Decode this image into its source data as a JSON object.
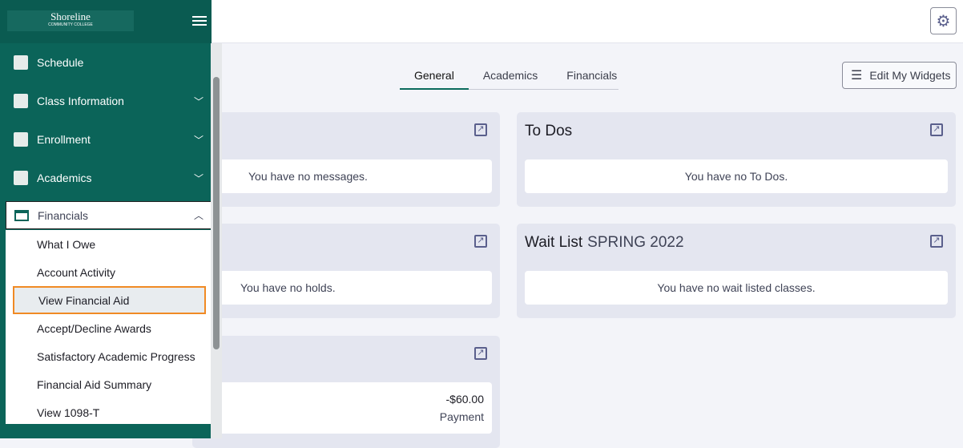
{
  "header": {
    "settings_icon": "gear-icon"
  },
  "tabs": [
    {
      "label": "General",
      "active": true
    },
    {
      "label": "Academics"
    },
    {
      "label": "Financials"
    }
  ],
  "edit_widgets": "Edit My Widgets",
  "cards": {
    "messages": {
      "body": "You have no messages."
    },
    "todos": {
      "title": "To Dos",
      "body": "You have no To Dos."
    },
    "holds": {
      "body": "You have no holds."
    },
    "waitlist": {
      "title": "Wait List",
      "term": "SPRING 2022",
      "body": "You have no wait listed classes."
    },
    "account": {
      "amount": "-$60.00",
      "type": "Payment"
    }
  },
  "sidebar": {
    "logo": "Shoreline",
    "logo_sub": "COMMUNITY COLLEGE",
    "items": [
      {
        "label": "Schedule"
      },
      {
        "label": "Class Information"
      },
      {
        "label": "Enrollment"
      },
      {
        "label": "Academics"
      },
      {
        "label": "Financials"
      }
    ],
    "financials_sub": [
      "What I Owe",
      "Account Activity",
      "View Financial Aid",
      "Accept/Decline Awards",
      "Satisfactory Academic Progress",
      "Financial Aid Summary",
      "View 1098-T"
    ]
  },
  "colors": {
    "sidebar": "#0b6459",
    "highlight": "#f08a24"
  }
}
